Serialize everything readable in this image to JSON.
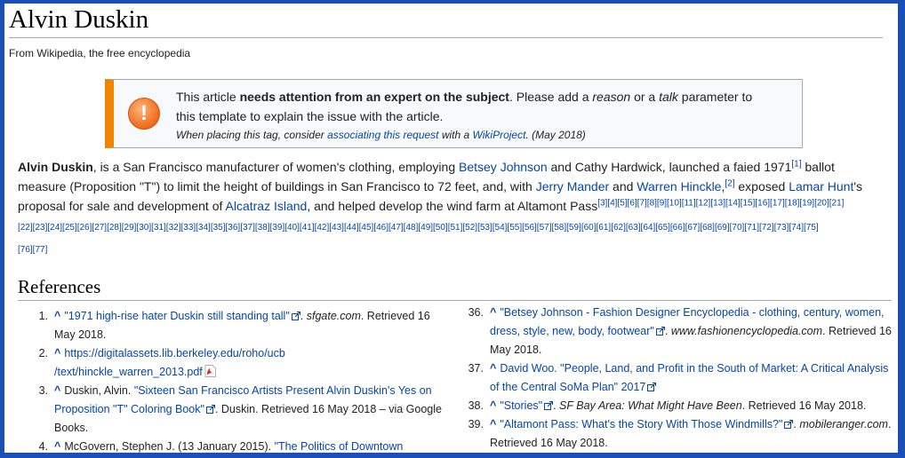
{
  "page": {
    "title": "Alvin Duskin",
    "tagline": "From Wikipedia, the free encyclopedia"
  },
  "notice": {
    "line1_pre": "This article ",
    "line1_bold": "needs attention from an expert on the subject",
    "line1_mid": ". Please add a ",
    "line1_reason": "reason",
    "line1_or": " or a ",
    "line1_talk": "talk",
    "line1_post": " parameter to",
    "line2": "this template to explain the issue with the article.",
    "hint_pre": "When placing this tag, consider ",
    "hint_link1": "associating this request",
    "hint_mid": " with a ",
    "hint_link2": "WikiProject",
    "hint_post": ". (May 2018)",
    "icon_glyph": "!",
    "icon": "warning-icon",
    "accent": "#f28500"
  },
  "intro": {
    "s1_bold": "Alvin Duskin",
    "s1": ", is a San Francisco manufacturer of women's clothing, employing ",
    "l_betsey": "Betsey Johnson",
    "s2": " and Cathy Hardwick, launched a faied 1971",
    "ref1": "[1]",
    "s3": " ballot measure (Proposition \"T\") to limit the height of buildings in San Francisco to 72 feet, and, with ",
    "l_mander": "Jerry Mander",
    "s4": " and ",
    "l_hinckle": "Warren Hinckle",
    "s5": ",",
    "ref2": "[2]",
    "s6": " exposed ",
    "l_hunt": "Lamar Hunt",
    "s7": "'s proposal for sale and development of ",
    "l_alcatraz": "Alcatraz Island",
    "s8": ", and helped develop the wind farm at Altamont Pass",
    "refs_a": "[3][4][5][6][7][8][9][10][11][12][13][14][15][16][17][18][19][20][21]",
    "refs_b": "[22][23][24][25][26][27][28][29][30][31][32][33][34][35][36][37][38][39][40][41][42][43][44][45][46][47][48][49][50][51][52][53][54][55][56][57][58][59][60][61][62][63][64][65][66][67][68][69][70][71][72][73][74][75]",
    "refs_c": "[76][77]"
  },
  "references": {
    "heading": "References",
    "caret": "^",
    "r1": {
      "num": "1.",
      "link": "\"1971 high-rise hater Duskin still standing tall\"",
      "pub": "sfgate.com",
      "rest": ". Retrieved 16 May 2018."
    },
    "r2": {
      "num": "2.",
      "link1": "https://digitalassets.lib.berkeley.edu/roho/ucb",
      "link2": "/text/hinckle_warren_2013.pdf"
    },
    "r3": {
      "num": "3.",
      "author": "Duskin, Alvin. ",
      "link": "\"Sixteen San Francisco Artists Present Alvin Duskin's Yes on Proposition \"T\" Coloring Book\"",
      "rest": ". Duskin. Retrieved 16 May 2018 – via Google Books."
    },
    "r4": {
      "num": "4.",
      "author": "McGovern, Stephen J. (13 January 2015). ",
      "link": "\"The Politics of Downtown"
    },
    "r36": {
      "num": "36.",
      "link": "\"Betsey Johnson - Fashion Designer Encyclopedia - clothing, century, women, dress, style, new, body, footwear\"",
      "pub": "www.fashionencyclopedia.com",
      "rest": ". Retrieved 16 May 2018."
    },
    "r37": {
      "num": "37.",
      "link": "David Woo. \"People, Land, and Profit in the South of Market: A Critical Analysis of the Central SoMa Plan\" 2017"
    },
    "r38": {
      "num": "38.",
      "link": "\"Stories\"",
      "pub": "SF Bay Area: What Might Have Been",
      "rest": ". Retrieved 16 May 2018."
    },
    "r39": {
      "num": "39.",
      "link": "\"Altamont Pass: What's the Story With Those Windmills?\"",
      "pub": "mobileranger.com",
      "rest": ". Retrieved 16 May 2018."
    }
  },
  "colors": {
    "frame": "#1a4fb8",
    "link": "#0645ad",
    "rule": "#a2a9b1"
  }
}
